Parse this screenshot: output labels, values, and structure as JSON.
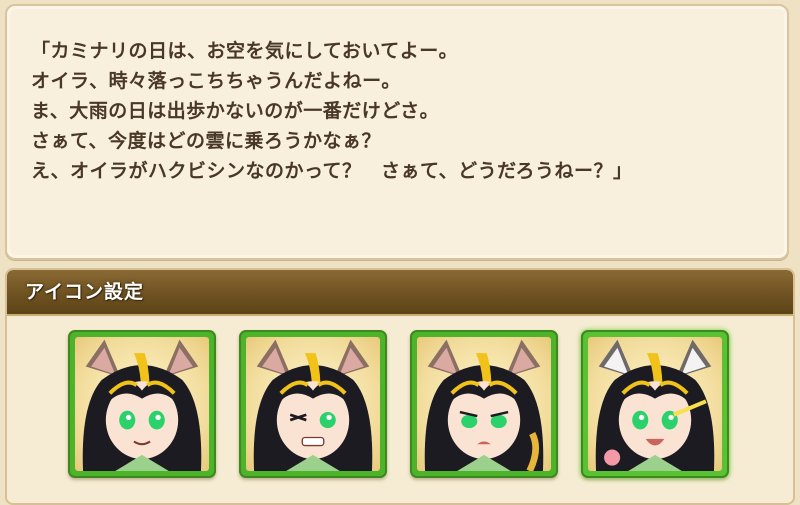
{
  "dialog": {
    "lines": [
      "「カミナリの日は、お空を気にしておいてよー。",
      "オイラ、時々落っこちちゃうんだよねー。",
      "ま、大雨の日は出歩かないのが一番だけどさ。",
      "さぁて、今度はどの雲に乗ろうかなぁ？",
      "え、オイラがハクビシンなのかって？　さぁて、どうだろうねー？」"
    ]
  },
  "icon_settings": {
    "title": "アイコン設定",
    "icons": [
      {
        "expression": "smile",
        "ears": "brown",
        "selected": false
      },
      {
        "expression": "wink-grimace",
        "ears": "brown",
        "selected": false
      },
      {
        "expression": "worried",
        "ears": "brown",
        "selected": false
      },
      {
        "expression": "excited",
        "ears": "white",
        "selected": true
      }
    ]
  },
  "colors": {
    "background": "#efe2c4",
    "panel": "#f8f0dd",
    "header": "#6f5222",
    "icon_frame": "#4db32a",
    "hair_stripe": "#f1c21a",
    "eyes": "#2bd16b"
  }
}
